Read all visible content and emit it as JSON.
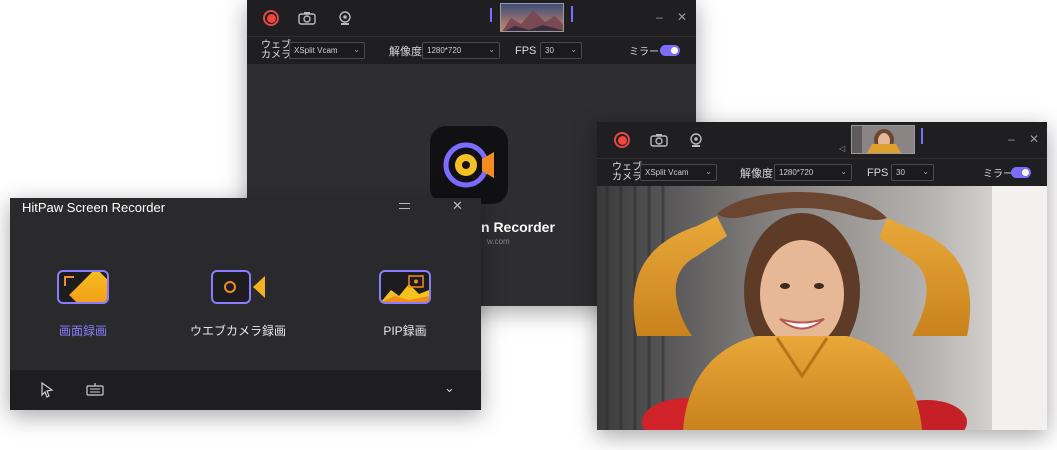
{
  "back_window": {
    "settings": {
      "webcam_label": "ウェブ\nカメラ",
      "webcam_value": "XSplit Vcam",
      "resolution_label": "解像度",
      "resolution_value": "1280*720",
      "fps_label": "FPS",
      "fps_value": "30",
      "mirror_label": "ミラー"
    },
    "app_name_partial": "n Recorder",
    "website_partial": "w.com"
  },
  "main_window": {
    "title": "HitPaw Screen Recorder",
    "modes": [
      {
        "label": "画面録画",
        "selected": true
      },
      {
        "label": "ウエブカメラ録画",
        "selected": false
      },
      {
        "label": "PIP録画",
        "selected": false
      }
    ]
  },
  "front_window": {
    "settings": {
      "webcam_label": "ウェブ\nカメラ",
      "webcam_value": "XSplit Vcam",
      "resolution_label": "解像度",
      "resolution_value": "1280*720",
      "fps_label": "FPS",
      "fps_value": "30",
      "mirror_label": "ミラー"
    }
  },
  "colors": {
    "accent": "#7c6cff",
    "record": "#f2453d",
    "logo_orange": "#f28c1a",
    "logo_yellow": "#f5c21b"
  }
}
